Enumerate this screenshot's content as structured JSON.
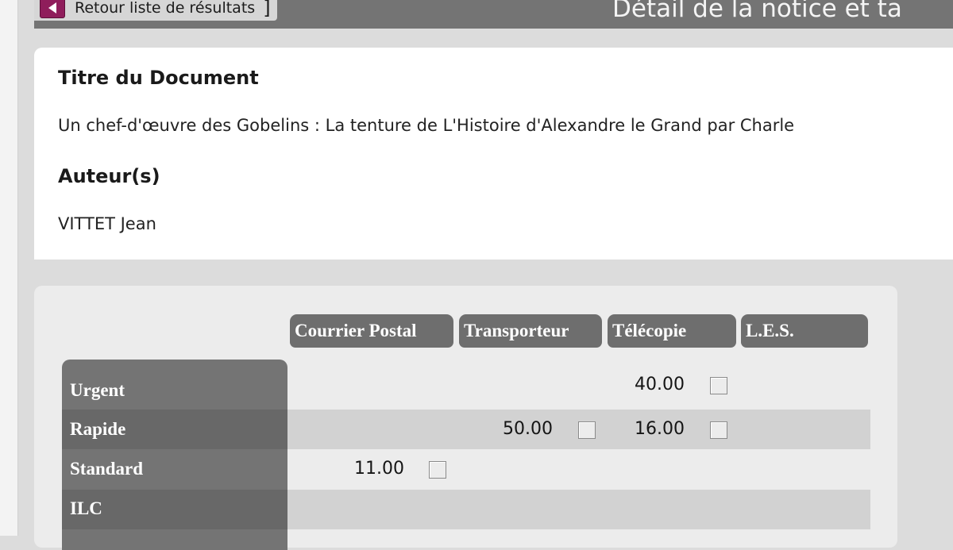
{
  "header": {
    "back_label": "Retour liste de résultats",
    "bracket": "]",
    "page_title": "Détail de la notice et ta"
  },
  "notice": {
    "title_label": "Titre du Document",
    "title_value": "Un chef-d'œuvre des Gobelins : La tenture de L'Histoire d'Alexandre le Grand par Charle",
    "author_label": "Auteur(s)",
    "author_value": "VITTET Jean"
  },
  "tarifs": {
    "columns": [
      "Courrier Postal",
      "Transporteur",
      "Télécopie",
      "L.E.S."
    ],
    "rows": [
      {
        "label": "Urgent",
        "prices": [
          "",
          "",
          "40.00",
          ""
        ]
      },
      {
        "label": "Rapide",
        "prices": [
          "",
          "50.00",
          "16.00",
          ""
        ]
      },
      {
        "label": "Standard",
        "prices": [
          "11.00",
          "",
          "",
          ""
        ]
      },
      {
        "label": "ILC",
        "prices": [
          "",
          "",
          "",
          ""
        ]
      }
    ]
  },
  "colors": {
    "header_bar": "#747474",
    "back_button": "#8f1d5b",
    "table_header": "#6e6e6e",
    "stripe": "#d2d2d2"
  },
  "icons": {
    "back": "left-triangle-arrow-icon"
  }
}
